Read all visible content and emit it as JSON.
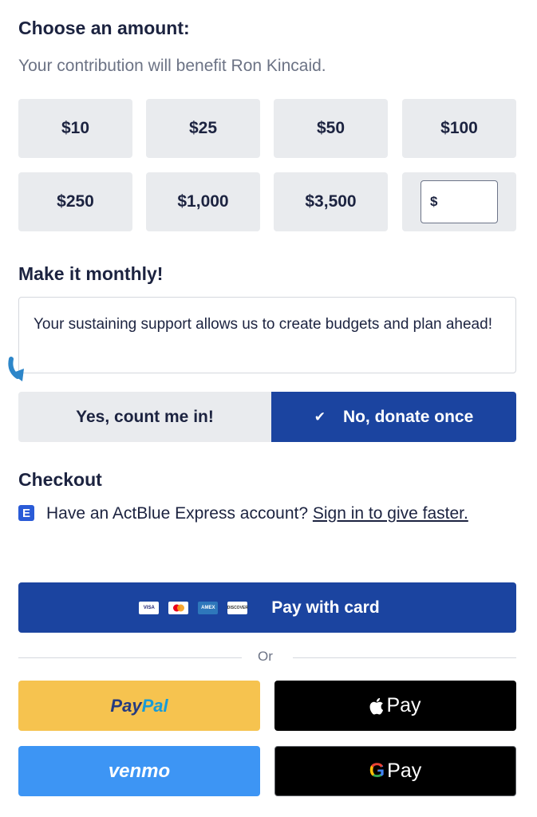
{
  "amount_section": {
    "title": "Choose an amount:",
    "subtitle": "Your contribution will benefit Ron Kincaid.",
    "amounts": [
      "$10",
      "$25",
      "$50",
      "$100",
      "$250",
      "$1,000",
      "$3,500"
    ],
    "custom_prefix": "$",
    "custom_value": ""
  },
  "monthly_section": {
    "title": "Make it monthly!",
    "info": "Your sustaining support allows us to create budgets and plan ahead!",
    "yes_label": "Yes, count me in!",
    "no_label": "No, donate once",
    "selected": "no"
  },
  "checkout": {
    "title": "Checkout",
    "express_badge": "E",
    "express_text": "Have an ActBlue Express account?",
    "express_link": "Sign in to give faster.",
    "pay_card_label": "Pay with card",
    "card_logos": [
      "VISA",
      "mastercard",
      "AMEX",
      "DISCOVER"
    ],
    "or_text": "Or",
    "paypal_part1": "Pay",
    "paypal_part2": "Pal",
    "apple_pay_label": "Pay",
    "venmo_label": "venmo",
    "google_pay_label": "Pay",
    "google_g": "G"
  },
  "colors": {
    "primary": "#1b44a0",
    "tile_bg": "#e9ebee",
    "paypal_yellow": "#f6c34f",
    "venmo_blue": "#3d95f4",
    "arrow_blue": "#2d86c9"
  }
}
